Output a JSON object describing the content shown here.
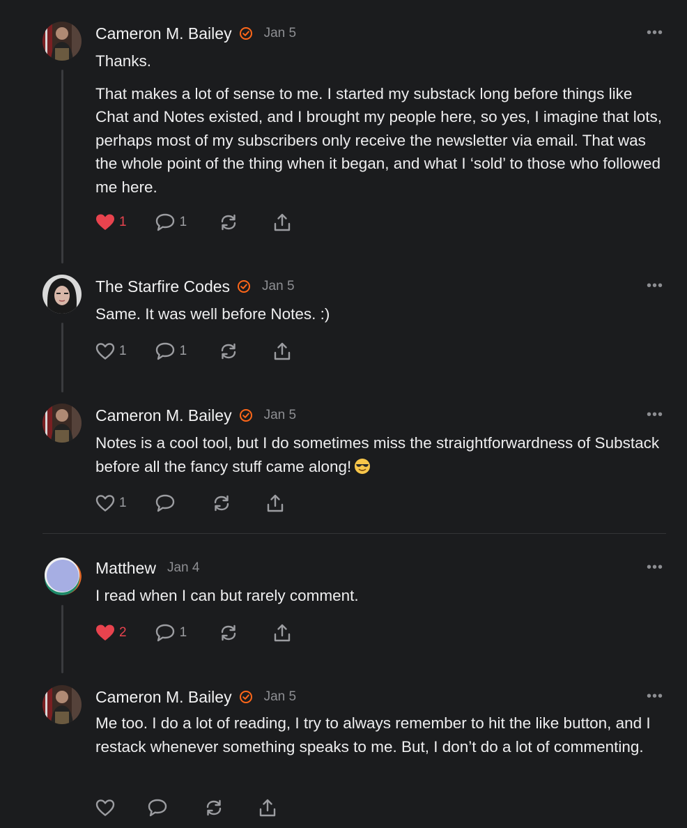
{
  "colors": {
    "background": "#1b1c1e",
    "accent": "#ff6719",
    "liked": "#e8434e",
    "muted": "#8d8e92"
  },
  "comments": [
    {
      "author": "Cameron M. Bailey",
      "verified": true,
      "date": "Jan 5",
      "paragraphs": [
        "Thanks.",
        "That makes a lot of sense to me. I started my substack long before things like Chat and Notes existed, and I brought my people here, so yes, I imagine that lots, perhaps most of my subscribers only receive the newsletter via email. That was the whole point of the thing when it began, and what I ‘sold’ to those who followed me here."
      ],
      "likes": "1",
      "liked": true,
      "replies": "1",
      "icons": [
        "heart-icon",
        "comment-icon",
        "restack-icon",
        "share-icon",
        "more-icon"
      ]
    },
    {
      "author": "The Starfire Codes",
      "verified": true,
      "date": "Jan 5",
      "paragraphs": [
        "Same. It was well before Notes. :)"
      ],
      "likes": "1",
      "liked": false,
      "replies": "1"
    },
    {
      "author": "Cameron M. Bailey",
      "verified": true,
      "date": "Jan 5",
      "paragraphs": [
        "Notes is a cool tool, but I do sometimes miss the straightforwardness of Substack before all the fancy stuff came along!"
      ],
      "emoji": "smiling-face-with-sunglasses",
      "likes": "1",
      "liked": false,
      "replies": ""
    },
    {
      "author": "Matthew",
      "verified": false,
      "date": "Jan 4",
      "paragraphs": [
        "I read when I can but rarely comment."
      ],
      "likes": "2",
      "liked": true,
      "replies": "1"
    },
    {
      "author": "Cameron M. Bailey",
      "verified": true,
      "date": "Jan 5",
      "paragraphs": [
        "Me too. I do a lot of reading, I try to always remember to hit the like button, and I restack whenever something speaks to me. But, I don’t do a lot of commenting."
      ],
      "likes": "",
      "liked": false,
      "replies": ""
    }
  ],
  "more_label": "•••"
}
